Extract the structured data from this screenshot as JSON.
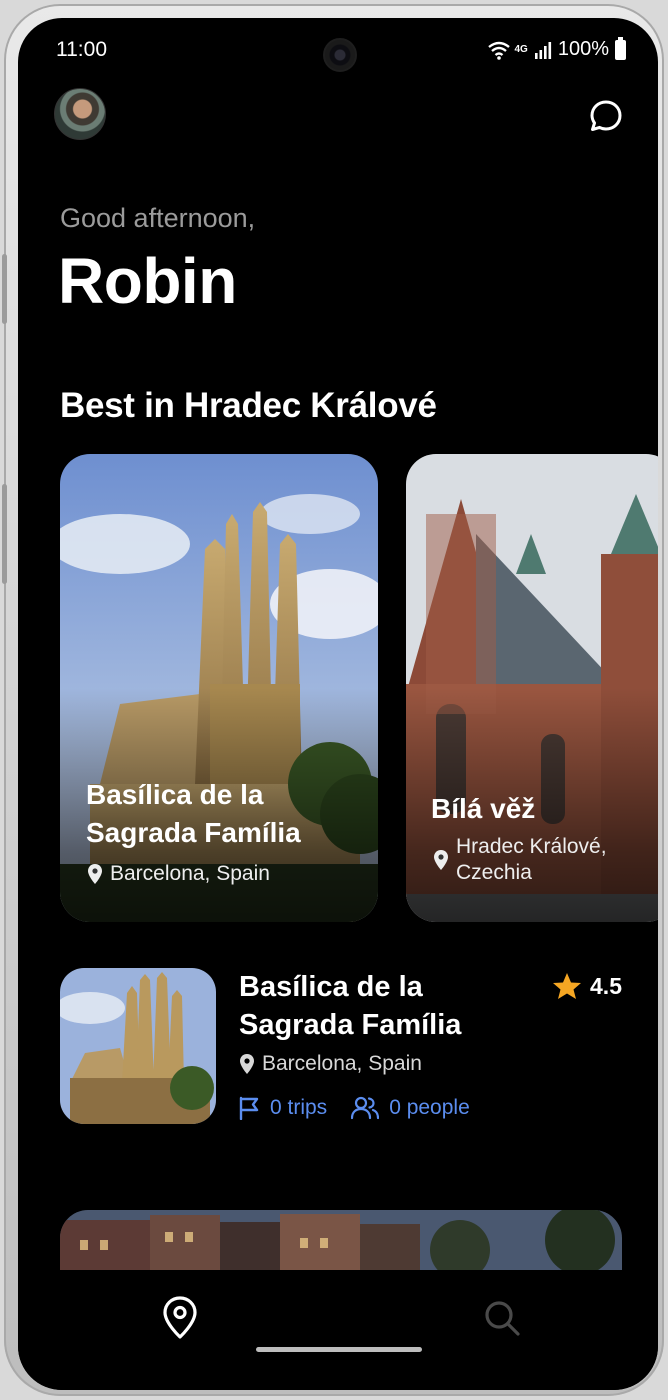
{
  "status_bar": {
    "time": "11:00",
    "network": "4G",
    "battery": "100%"
  },
  "header": {
    "greeting": "Good afternoon,",
    "user_name": "Robin"
  },
  "section": {
    "title": "Best in Hradec Králové"
  },
  "cards": [
    {
      "title": "Basílica de la Sagrada Família",
      "location": "Barcelona, Spain"
    },
    {
      "title": "Bílá věž",
      "location": "Hradec Králové, Czechia"
    }
  ],
  "list_item": {
    "title": "Basílica de la Sagrada Família",
    "location": "Barcelona, Spain",
    "rating": "4.5",
    "trips": "0 trips",
    "people": "0 people"
  },
  "nav": {
    "items": [
      {
        "icon": "map-pin-icon",
        "active": true
      },
      {
        "icon": "search-icon",
        "active": false
      }
    ]
  },
  "colors": {
    "accent": "#5b8def",
    "star": "#f5a623",
    "background": "#000000",
    "muted_text": "#9b9b9b"
  }
}
